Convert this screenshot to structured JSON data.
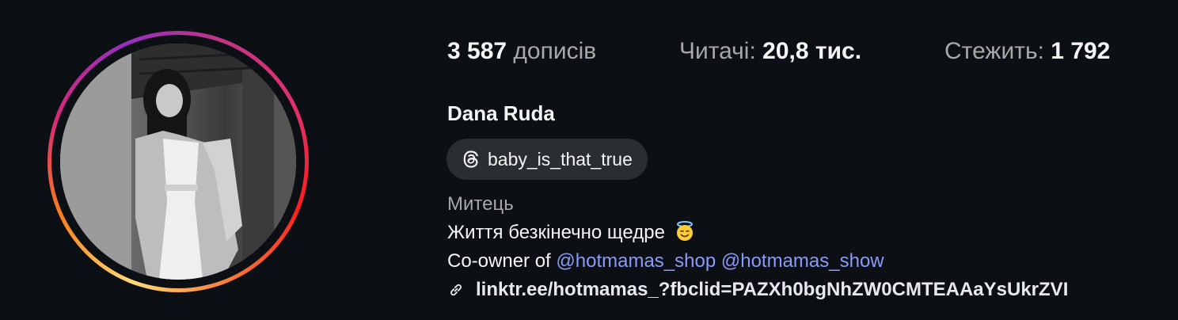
{
  "stats": {
    "posts": {
      "count": "3 587",
      "label": "дописів"
    },
    "followers": {
      "label": "Читачі:",
      "count": "20,8 тис."
    },
    "following": {
      "label": "Стежить:",
      "count": "1 792"
    }
  },
  "profile": {
    "name": "Dana Ruda",
    "threads_handle": "baby_is_that_true",
    "category": "Митець",
    "bio_line1": "Життя безкінечно щедре",
    "bio_line1_emoji": "smiling-face-with-halo-emoji",
    "bio_line2_prefix": "Co-owner of ",
    "mentions": [
      "@hotmamas_shop",
      "@hotmamas_show"
    ],
    "link": "linktr.ee/hotmamas_?fbclid=PAZXh0bgNhZW0CMTEAAaYsUkrZVI"
  },
  "icons": {
    "threads": "threads-icon",
    "link": "link-icon"
  },
  "colors": {
    "background": "#0c1014",
    "text": "#f5f5f5",
    "muted": "#a8a8a8",
    "mention": "#8a9af8",
    "chip": "#2a2d31"
  }
}
